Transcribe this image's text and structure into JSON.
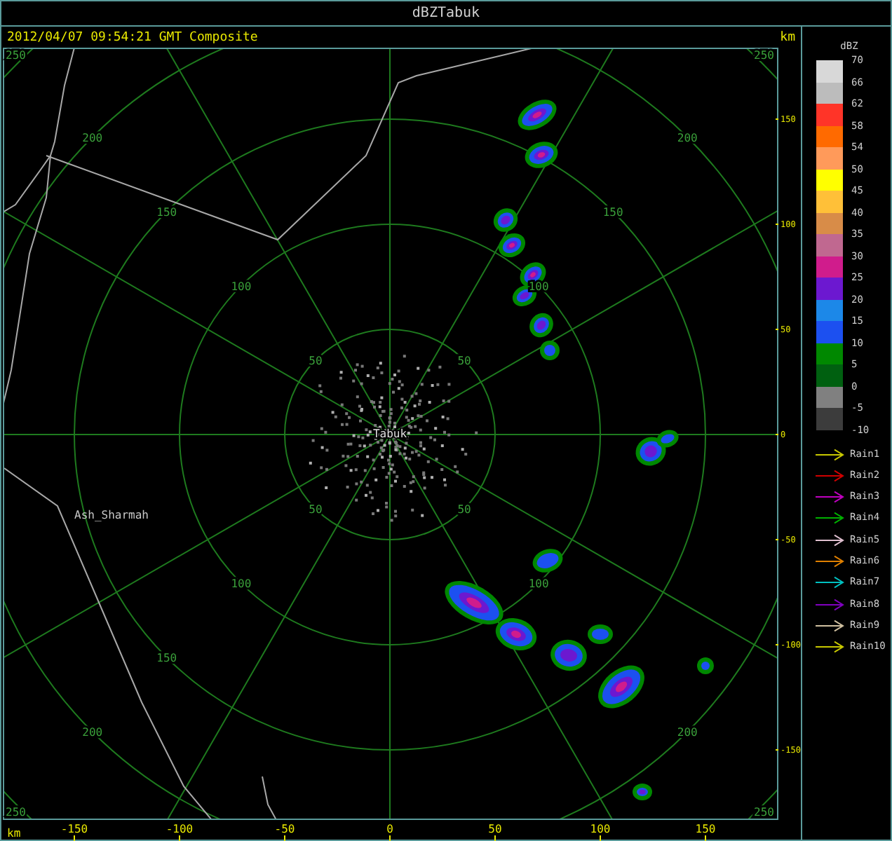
{
  "window": {
    "title": "dBZTabuk"
  },
  "header": {
    "caption": "2012/04/07 09:54:21 GMT Composite",
    "unit": "km"
  },
  "plot": {
    "rings": [
      {
        "nw": "50",
        "ne": "50",
        "sw": "50",
        "se": "50"
      },
      {
        "nw": "100",
        "ne": "100",
        "sw": "100",
        "se": "100"
      },
      {
        "nw": "150",
        "ne": "150",
        "sw": "150"
      },
      {
        "nw": "200",
        "ne": "200",
        "sw": "200",
        "se": "200"
      },
      {
        "nw": "250",
        "ne": "250",
        "sw": "250",
        "se": "250"
      }
    ],
    "site": "Tabuk",
    "places": [
      {
        "name": "Ash_Sharmah"
      }
    ]
  },
  "right_axis": {
    "ticks": [
      "150",
      "100",
      "50",
      "0",
      "-50",
      "-100",
      "-150"
    ]
  },
  "bottom_axis": {
    "unit": "km",
    "ticks": [
      "-150",
      "-100",
      "-50",
      "0",
      "50",
      "100",
      "150"
    ]
  },
  "legend": {
    "title": "dBZ",
    "steps": [
      {
        "label": "70",
        "color": "#d8d8d8"
      },
      {
        "label": "66",
        "color": "#bcbcbc"
      },
      {
        "label": "62",
        "color": "#ff3428"
      },
      {
        "label": "58",
        "color": "#ff6a00"
      },
      {
        "label": "54",
        "color": "#ff9a5a"
      },
      {
        "label": "50",
        "color": "#ffff00"
      },
      {
        "label": "45",
        "color": "#ffc038"
      },
      {
        "label": "40",
        "color": "#d88c48"
      },
      {
        "label": "35",
        "color": "#c06890"
      },
      {
        "label": "30",
        "color": "#d01c8c"
      },
      {
        "label": "25",
        "color": "#6c18d0"
      },
      {
        "label": "20",
        "color": "#1c88e8"
      },
      {
        "label": "15",
        "color": "#1c50f0"
      },
      {
        "label": "10",
        "color": "#008800"
      },
      {
        "label": "5",
        "color": "#006010"
      },
      {
        "label": "0",
        "color": "#808080"
      },
      {
        "label": "-5",
        "color": "#3c3c3c"
      }
    ],
    "last_label": "-10"
  },
  "tracks": [
    {
      "label": "Rain1",
      "color": "#c8c800"
    },
    {
      "label": "Rain2",
      "color": "#d00000"
    },
    {
      "label": "Rain3",
      "color": "#c000c0"
    },
    {
      "label": "Rain4",
      "color": "#00b000"
    },
    {
      "label": "Rain5",
      "color": "#e0c0d0"
    },
    {
      "label": "Rain6",
      "color": "#e08000"
    },
    {
      "label": "Rain7",
      "color": "#00c0c0"
    },
    {
      "label": "Rain8",
      "color": "#8000c0"
    },
    {
      "label": "Rain9",
      "color": "#d0c0a0"
    },
    {
      "label": "Rain10",
      "color": "#c8c800"
    }
  ]
}
